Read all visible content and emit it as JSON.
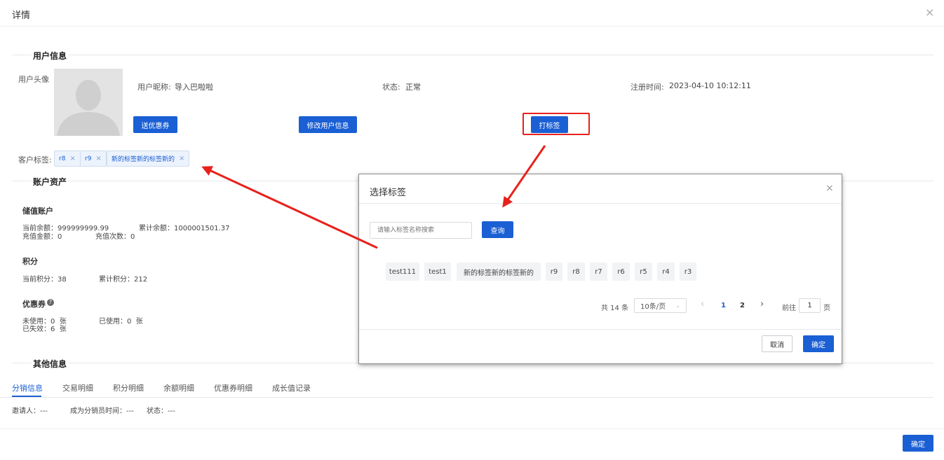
{
  "header": {
    "title": "详情",
    "close_glyph": "×"
  },
  "user_info": {
    "section_title": "用户信息",
    "avatar_label": "用户头像",
    "nickname_label": "用户昵称:",
    "nickname_value": "导入巴啦啦",
    "status_label": "状态:",
    "status_value": "正常",
    "register_label": "注册时间:",
    "register_value": "2023-04-10 10:12:11",
    "buttons": {
      "coupon": "送优惠券",
      "edit": "修改用户信息",
      "tag": "打标签"
    },
    "customer_tags_label": "客户标签:",
    "customer_tags": [
      "r8",
      "r9",
      "新的标签新的标签新的"
    ],
    "tag_close_glyph": "×"
  },
  "account_assets": {
    "section_title": "账户资产",
    "stored_value": {
      "title": "储值账户",
      "current_balance": "当前余额：999999999.99",
      "total_balance": "累计余额：1000001501.37",
      "recharge_amount": "充值金额：0",
      "recharge_count": "充值次数：0"
    },
    "points": {
      "title": "积分",
      "current": "当前积分：38",
      "total": "累计积分：212"
    },
    "coupons": {
      "title": "优惠券",
      "help_glyph": "?",
      "unused": "未使用：0  张",
      "used": "已使用：0  张",
      "expired": "已失效：6  张"
    }
  },
  "other_info": {
    "section_title": "其他信息",
    "tabs": [
      "分销信息",
      "交易明细",
      "积分明细",
      "余额明细",
      "优惠券明细",
      "成长值记录"
    ],
    "inviter": "邀请人：---",
    "distributor_time": "成为分销员时间：---",
    "status": "状态：---"
  },
  "footer": {
    "confirm": "确定"
  },
  "dialog": {
    "title": "选择标签",
    "close_glyph": "×",
    "search_placeholder": "请输入标签名称搜索",
    "search_button": "查询",
    "tags": [
      "test111",
      "test1",
      "新的标签新的标签新的",
      "r9",
      "r8",
      "r7",
      "r6",
      "r5",
      "r4",
      "r3"
    ],
    "pagination": {
      "total": "共 14 条",
      "page_size": "10条/页",
      "prev_glyph": "‹",
      "next_glyph": "›",
      "pages": [
        "1",
        "2"
      ],
      "current_page": "1",
      "goto_prefix": "前往",
      "goto_value": "1",
      "goto_suffix": "页"
    },
    "cancel": "取消",
    "confirm": "确定"
  },
  "colors": {
    "primary": "#1a5fd4",
    "annotation": "#e8211c"
  }
}
